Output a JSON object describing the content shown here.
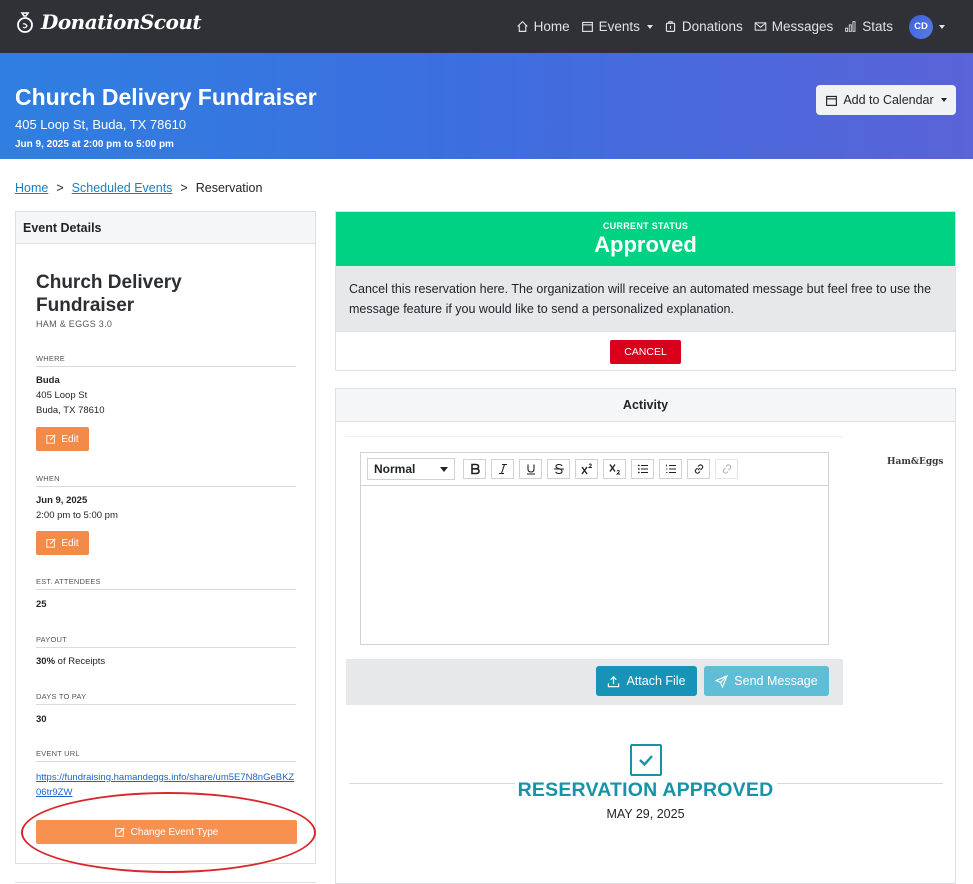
{
  "brand": {
    "name": "DonationScout"
  },
  "nav": {
    "home": "Home",
    "events": "Events",
    "donations": "Donations",
    "messages": "Messages",
    "stats": "Stats",
    "avatar_initials": "CD"
  },
  "hero": {
    "title": "Church Delivery Fundraiser",
    "address": "405 Loop St, Buda, TX 78610",
    "datetime": "Jun 9, 2025 at 2:00 pm to 5:00 pm",
    "calendar_button": "Add to Calendar"
  },
  "breadcrumb": {
    "home": "Home",
    "scheduled": "Scheduled Events",
    "current": "Reservation",
    "separator": ">"
  },
  "event_details": {
    "header": "Event Details",
    "name": "Church Delivery Fundraiser",
    "organization": "HAM & EGGS 3.0",
    "where_label": "WHERE",
    "where_city": "Buda",
    "where_street": "405 Loop St",
    "where_citystate": "Buda, TX 78610",
    "edit_label": "Edit",
    "when_label": "WHEN",
    "when_date": "Jun 9, 2025",
    "when_time": "2:00 pm to 5:00 pm",
    "attendees_label": "EST. ATTENDEES",
    "attendees_value": "25",
    "payout_label": "PAYOUT",
    "payout_percent": "30%",
    "payout_suffix": " of Receipts",
    "days_label": "DAYS TO PAY",
    "days_value": "30",
    "url_label": "EVENT URL",
    "url_value": "https://fundraising.hamandeggs.info/share/um5E7N8nGeBKZ06tr9ZW",
    "change_type_button": "Change Event Type"
  },
  "status": {
    "label": "CURRENT STATUS",
    "value": "Approved",
    "message": "Cancel this reservation here. The organization will receive an automated message but feel free to use the message feature if you would like to send a personalized explanation.",
    "cancel_button": "CANCEL"
  },
  "activity": {
    "header": "Activity",
    "format_select": "Normal",
    "attach_button": "Attach File",
    "send_button": "Send Message",
    "org_logo_text": "Ham&Eggs",
    "approved_title": "RESERVATION APPROVED",
    "approved_date": "MAY 29, 2025"
  },
  "colors": {
    "navbar": "#2f3137",
    "hero_gradient_start": "#2f7fe0",
    "hero_gradient_end": "#5a63d8",
    "status_green": "#00d283",
    "cancel_red": "#d9001b",
    "edit_orange": "#f28a4a",
    "teal_accent": "#1793a8",
    "annotation_red": "#d9262a"
  }
}
